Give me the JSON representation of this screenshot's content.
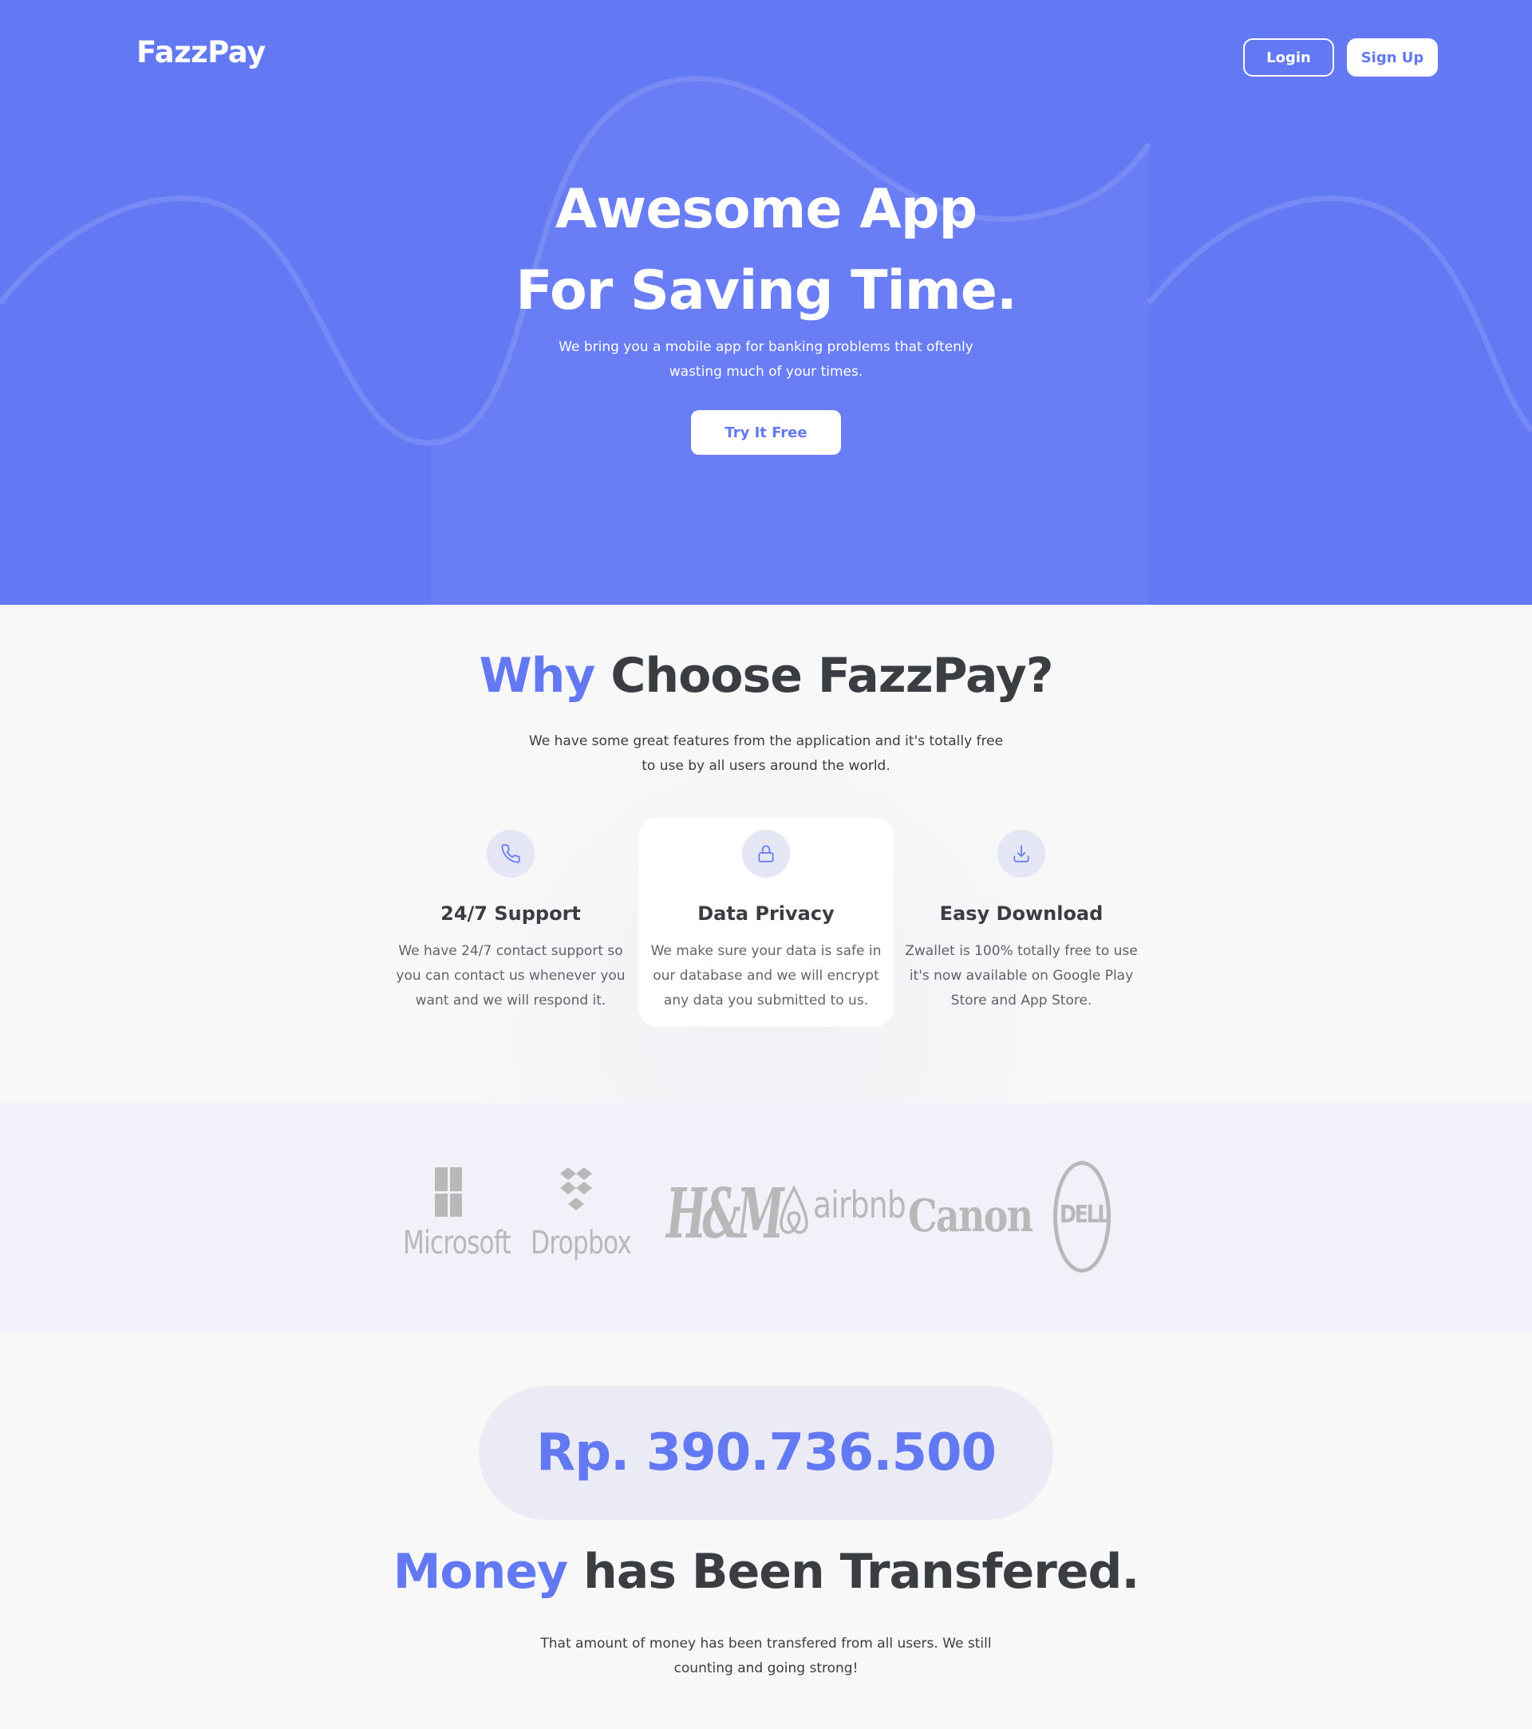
{
  "brand": {
    "name": "FazzPay",
    "accent": "#6379f4"
  },
  "nav": {
    "login_label": "Login",
    "signup_label": "Sign Up"
  },
  "hero": {
    "title_line1": "Awesome App",
    "title_line2": "For Saving Time.",
    "subtitle": "We bring you a mobile app for banking problems that oftenly wasting much of your times.",
    "cta_label": "Try It Free"
  },
  "why": {
    "title_accent": "Why",
    "title_rest": " Choose FazzPay?",
    "subtitle": "We have some great features from the application and it's totally free to use by all users around the world.",
    "features": [
      {
        "icon": "phone-icon",
        "title": "24/7 Support",
        "text": "We have 24/7 contact support so you can contact us whenever you want and we will respond it."
      },
      {
        "icon": "lock-icon",
        "title": "Data Privacy",
        "text": "We make sure your data is safe in our database and we will encrypt any data you submitted to us."
      },
      {
        "icon": "download-icon",
        "title": "Easy Download",
        "text": "Zwallet is 100% totally free to use it's now available on Google Play Store and App Store."
      }
    ]
  },
  "partners": [
    {
      "name": "Microsoft"
    },
    {
      "name": "Dropbox"
    },
    {
      "name": "H&M"
    },
    {
      "name": "airbnb"
    },
    {
      "name": "Canon"
    },
    {
      "name": "DELL"
    }
  ],
  "money": {
    "amount": "Rp. 390.736.500",
    "title_accent": "Money",
    "title_rest": " has Been Transfered.",
    "subtitle": "That amount of money has been transfered from all users. We still counting and going strong!"
  }
}
